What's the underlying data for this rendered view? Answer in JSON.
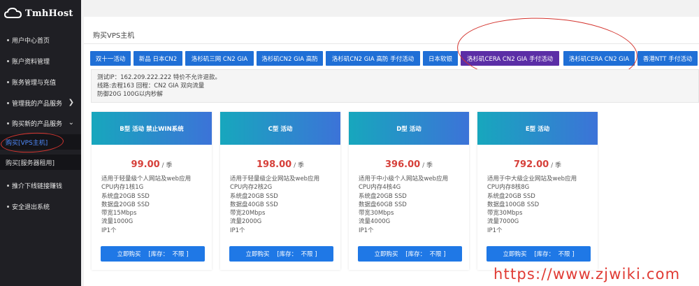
{
  "sidebar": {
    "logo": "TmhHost",
    "items": [
      {
        "label": "用户中心首页"
      },
      {
        "label": "账户资料管理"
      },
      {
        "label": "账务管理与充值"
      },
      {
        "label": "管理我的产品服务"
      },
      {
        "label": "购买新的产品服务"
      },
      {
        "label": "推介下线链接赚钱"
      },
      {
        "label": "安全退出系统"
      }
    ],
    "subitems": [
      {
        "label": "购买[VPS主机]"
      },
      {
        "label": "购买[服务器租用]"
      }
    ]
  },
  "page": {
    "title": "购买VPS主机"
  },
  "tabs": [
    {
      "label": "双十一活动"
    },
    {
      "label": "新品 日本CN2"
    },
    {
      "label": "洛杉矶三网 CN2 GIA"
    },
    {
      "label": "洛杉矶CN2 GIA 高防"
    },
    {
      "label": "洛杉矶CN2 GIA 高防 手付活动"
    },
    {
      "label": "日本软银"
    },
    {
      "label": "洛杉矶CERA CN2 GIA 手付活动"
    },
    {
      "label": "洛杉矶CERA CN2 GIA"
    },
    {
      "label": "香港NTT 手付活动"
    }
  ],
  "info": {
    "line1": "测试IP：162.209.222.222 特价不允许退款。",
    "line2": "线路:去程163 回程：CN2 GIA 双向流量",
    "line3": "防御20G 100G以内秒解"
  },
  "products": [
    {
      "name": "B型 活动 禁止WIN系统",
      "price": "99.00",
      "unit": "/ 季",
      "specs": [
        "适用于轻量级个人网站及web应用",
        "CPU内存1核1G",
        "系统盘20GB SSD",
        "数据盘20GB SSD",
        "带宽15Mbps",
        "流量1000G",
        "IP1个"
      ],
      "buy_label": "立即购买    [库存：  不限 ]"
    },
    {
      "name": "C型 活动",
      "price": "198.00",
      "unit": "/ 季",
      "specs": [
        "适用于轻量级企业网站及web应用",
        "CPU内存2核2G",
        "系统盘20GB SSD",
        "数据盘40GB SSD",
        "带宽20Mbps",
        "流量2000G",
        "IP1个"
      ],
      "buy_label": "立即购买    [库存：  不限 ]"
    },
    {
      "name": "D型 活动",
      "price": "396.00",
      "unit": "/ 季",
      "specs": [
        "适用于中小级个人网站及web应用",
        "CPU内存4核4G",
        "系统盘20GB SSD",
        "数据盘60GB SSD",
        "带宽30Mbps",
        "流量4000G",
        "IP1个"
      ],
      "buy_label": "立即购买    [库存：  不限 ]"
    },
    {
      "name": "E型 活动",
      "price": "792.00",
      "unit": "/ 季",
      "specs": [
        "适用于中大级企业网站及web应用",
        "CPU内存8核8G",
        "系统盘20GB SSD",
        "数据盘100GB SSD",
        "带宽30Mbps",
        "流量7000G",
        "IP1个"
      ],
      "buy_label": "立即购买    [库存：  不限 ]"
    }
  ],
  "watermark": "https://www.zjwiki.com",
  "colors": {
    "sidebar_bg": "#1f1f24",
    "tab_blue": "#1f6fd6",
    "tab_active_purple": "#5b2ea6",
    "price_red": "#d6403a",
    "annotation_red": "#d4352f"
  }
}
